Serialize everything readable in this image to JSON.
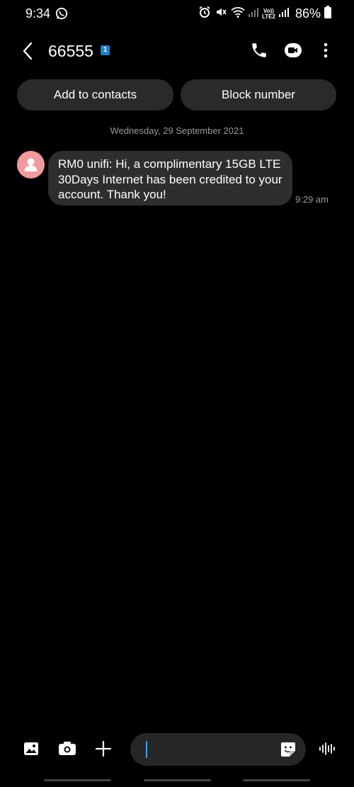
{
  "status_bar": {
    "time": "9:34",
    "network_label_top": "Vo))",
    "network_label_bottom": "LTE2",
    "battery": "86%"
  },
  "header": {
    "title": "66555",
    "sim_badge": "1"
  },
  "actions": {
    "add_contact": "Add to contacts",
    "block_number": "Block number"
  },
  "conversation": {
    "date": "Wednesday, 29 September 2021",
    "messages": [
      {
        "text": "RM0 unifi: Hi, a complimentary 15GB LTE 30Days Internet has been credited to your account. Thank you!",
        "time": "9:29 am"
      }
    ]
  },
  "composer": {
    "icons": [
      "gallery-icon",
      "camera-icon",
      "add-icon",
      "sticker-icon",
      "voice-icon"
    ]
  },
  "colors": {
    "background": "#000000",
    "bubble": "#2e2e2e",
    "button": "#2a2a2a",
    "avatar": "#f19a9d",
    "cursor": "#3aa0ff",
    "sim_badge": "#1f7fc8"
  }
}
